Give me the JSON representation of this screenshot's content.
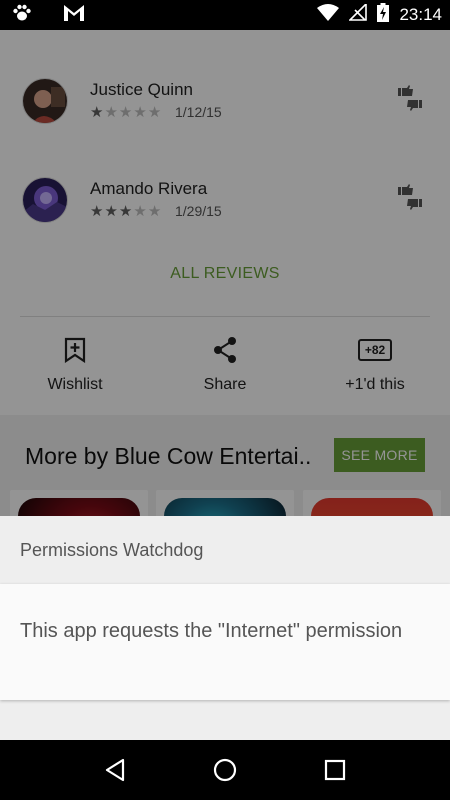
{
  "status_bar": {
    "time": "23:14",
    "icons": [
      "paw-icon",
      "gmail-icon",
      "wifi-icon",
      "no-signal-icon",
      "battery-charging-icon"
    ]
  },
  "reviews": [
    {
      "name": "Justice Quinn",
      "rating": 1,
      "max_rating": 5,
      "date": "1/12/15"
    },
    {
      "name": "Amando Rivera",
      "rating": 3,
      "max_rating": 5,
      "date": "1/29/15"
    }
  ],
  "all_reviews_label": "ALL REVIEWS",
  "actions": [
    {
      "label": "Wishlist",
      "icon": "bookmark-plus-icon"
    },
    {
      "label": "Share",
      "icon": "share-icon"
    },
    {
      "label": "+1'd this",
      "icon": "plus-one-icon",
      "badge": "+82"
    }
  ],
  "more_section": {
    "title": "More by Blue Cow Entertai..",
    "see_more_label": "SEE MORE"
  },
  "dialog": {
    "title": "Permissions Watchdog",
    "message": "This app requests the \"Internet\" permission"
  },
  "nav_bar": {
    "icons": [
      "back-icon",
      "home-icon",
      "recents-icon"
    ]
  },
  "colors": {
    "accent": "#689f38",
    "scrim": "rgba(0,0,0,0.42)"
  }
}
